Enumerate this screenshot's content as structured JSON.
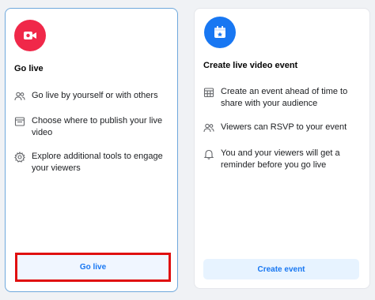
{
  "golive_card": {
    "title": "Go live",
    "icon": "video-camera-icon",
    "accent": "#f02849",
    "features": [
      {
        "icon": "people-icon",
        "text": "Go live by yourself or with others"
      },
      {
        "icon": "layout-icon",
        "text": "Choose where to publish your live video"
      },
      {
        "icon": "gear-icon",
        "text": "Explore additional tools to engage your viewers"
      }
    ],
    "button_label": "Go live"
  },
  "event_card": {
    "title": "Create live video event",
    "icon": "calendar-icon",
    "accent": "#1877f2",
    "features": [
      {
        "icon": "calendar-grid-icon",
        "text": "Create an event ahead of time to share with your audience"
      },
      {
        "icon": "people-icon",
        "text": "Viewers can RSVP to your event"
      },
      {
        "icon": "bell-icon",
        "text": "You and your viewers will get a reminder before you go live"
      }
    ],
    "button_label": "Create event"
  }
}
